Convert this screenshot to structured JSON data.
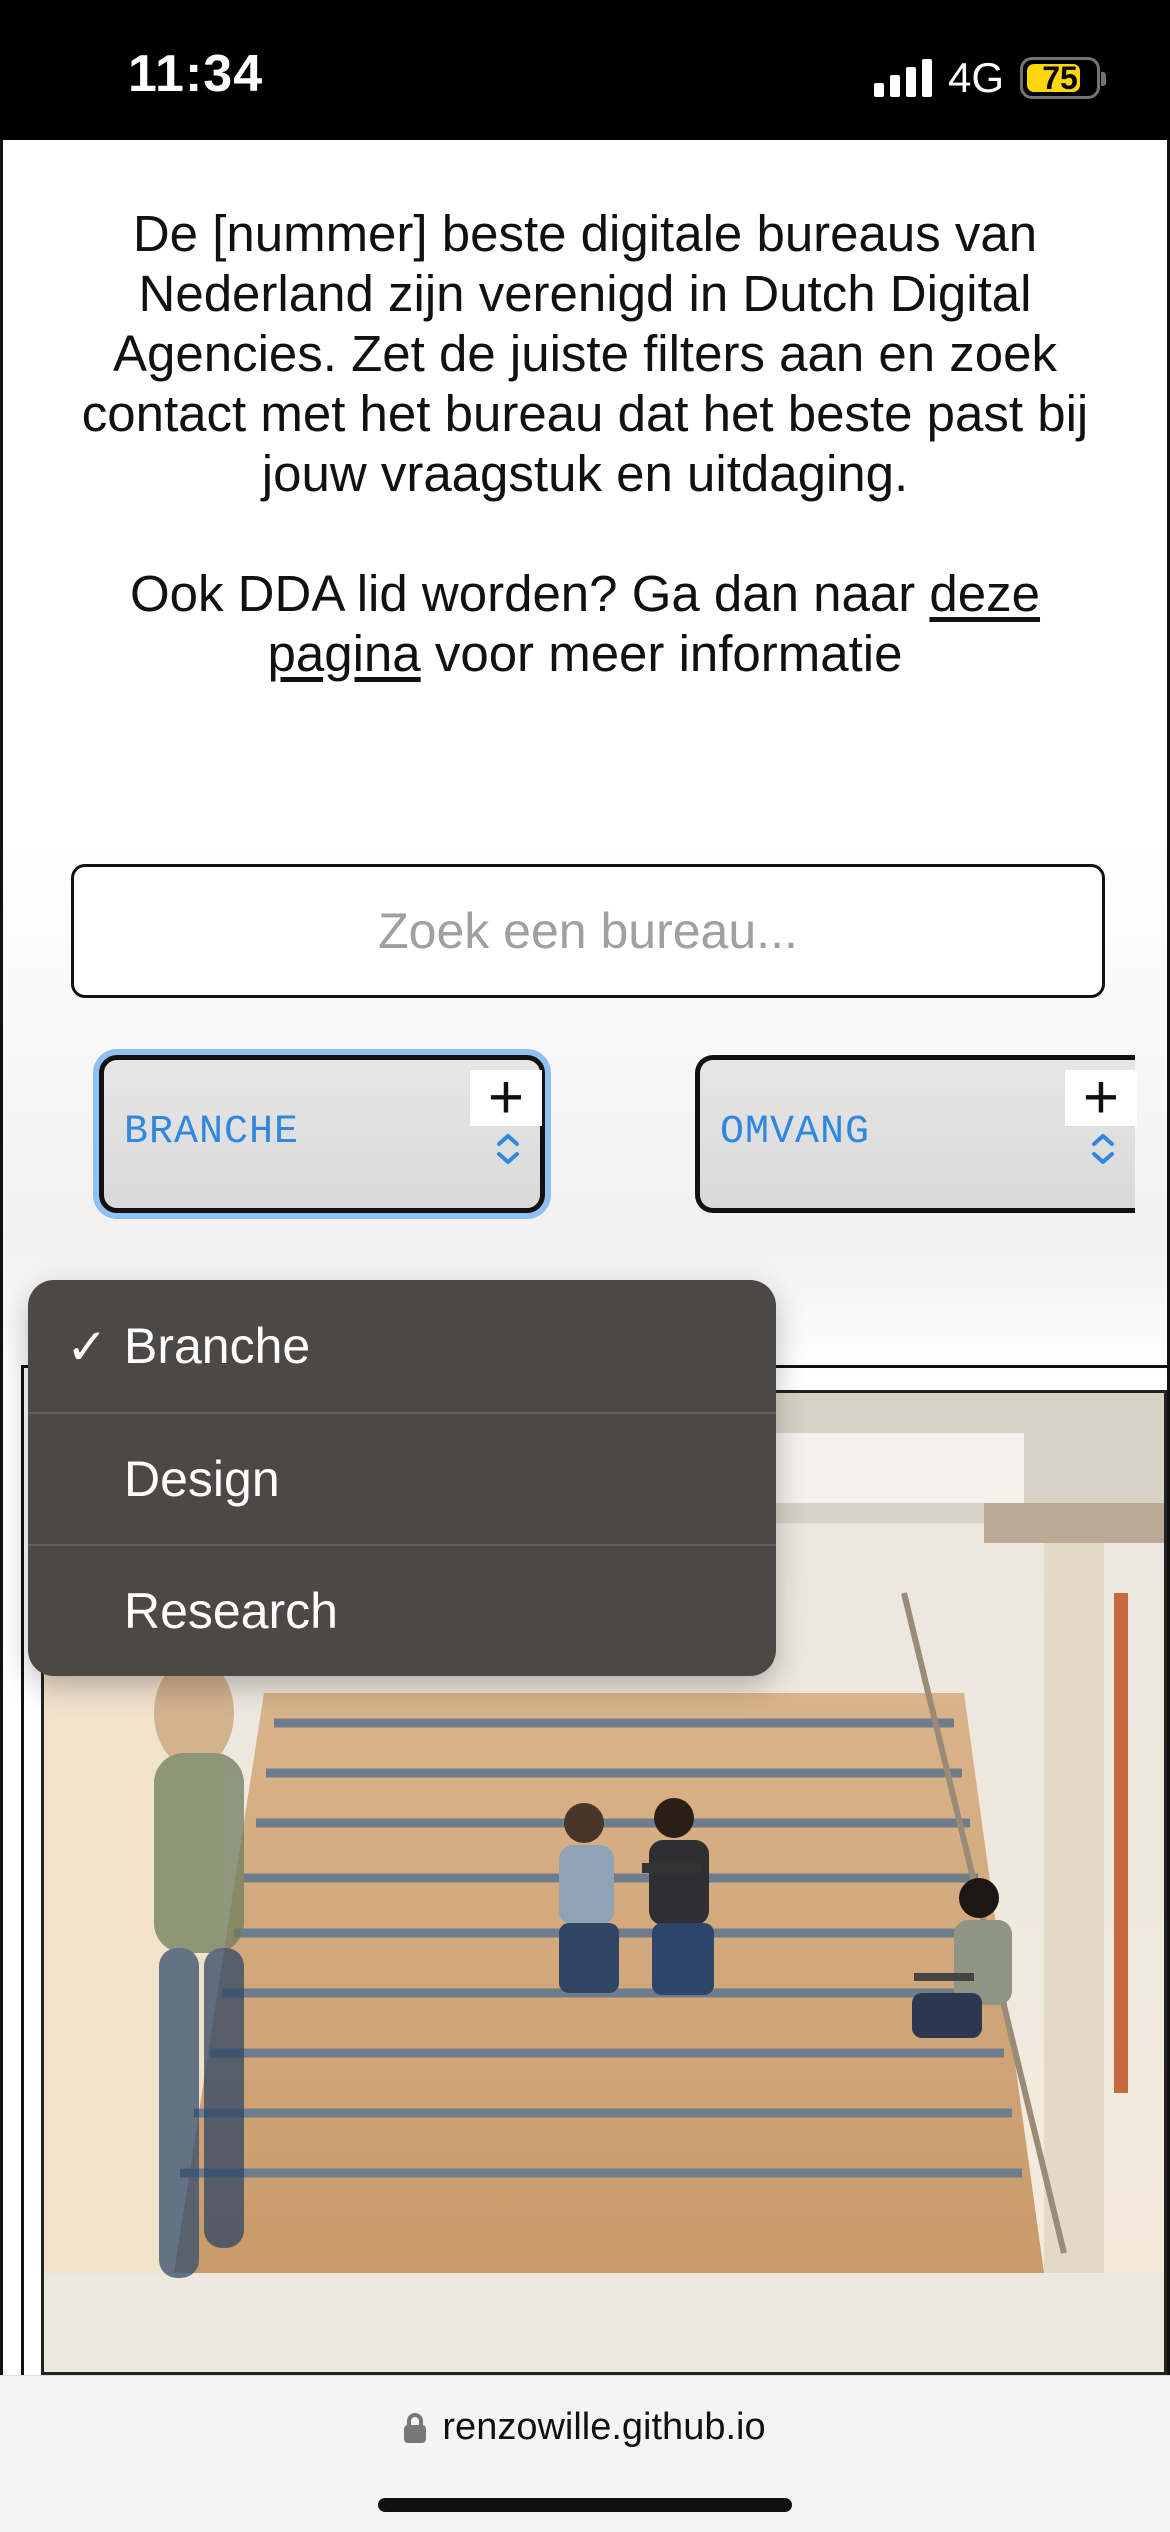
{
  "status_bar": {
    "time": "11:34",
    "network": "4G",
    "battery": "75"
  },
  "intro": {
    "paragraph1": "De [nummer] beste digitale bureaus van Nederland zijn verenigd in Dutch Digital Agencies. Zet de juiste filters aan en zoek contact met het bureau dat het beste past bij jouw vraagstuk en uitdaging.",
    "paragraph2_prefix": "Ook DDA lid worden? Ga dan naar ",
    "paragraph2_link": "deze pagina",
    "paragraph2_suffix": " voor meer informatie"
  },
  "search": {
    "placeholder": "Zoek een bureau..."
  },
  "filters": [
    {
      "label": "BRANCHE",
      "plus": "+"
    },
    {
      "label": "OMVANG",
      "plus": "+"
    }
  ],
  "dropdown": {
    "options": [
      {
        "label": "Branche",
        "selected": true
      },
      {
        "label": "Design",
        "selected": false
      },
      {
        "label": "Research",
        "selected": false
      }
    ],
    "check": "✓"
  },
  "browser": {
    "url": "renzowille.github.io"
  },
  "colors": {
    "accent": "#2f87e0",
    "focus_ring": "#8fc0f2",
    "menu_bg": "#4b4846",
    "battery": "#ffd60a"
  }
}
